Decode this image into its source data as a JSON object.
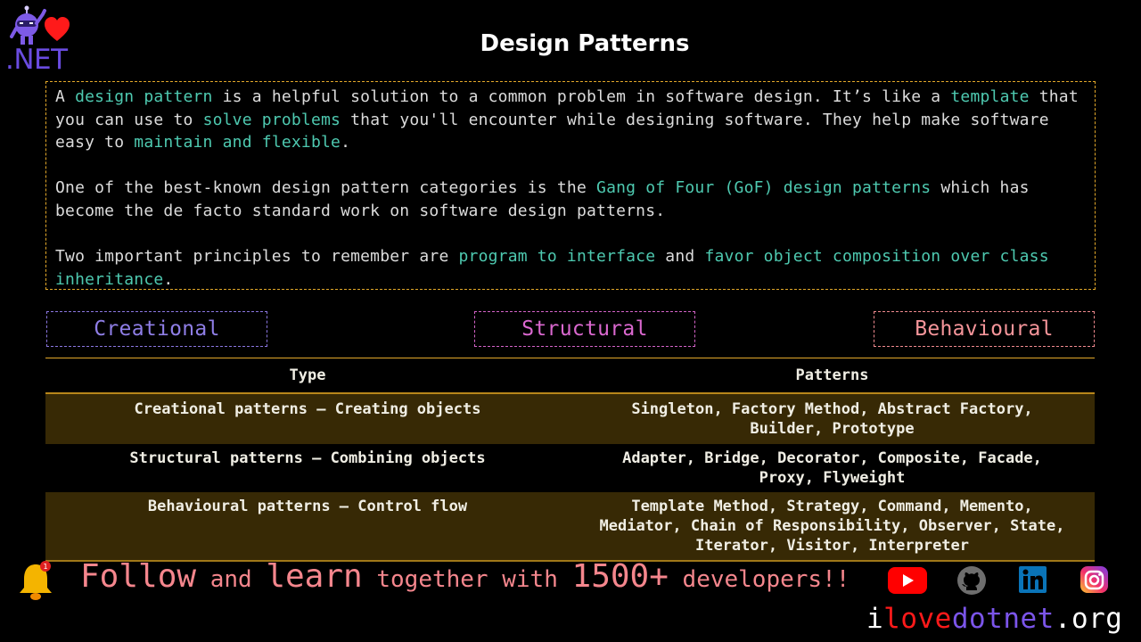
{
  "header": {
    "logo_text": ".NET",
    "title": "Design Patterns"
  },
  "intro": {
    "paragraphs": [
      [
        {
          "t": "A ",
          "hl": false
        },
        {
          "t": "design pattern",
          "hl": true
        },
        {
          "t": " is a helpful solution to a common problem in software design. It’s like a ",
          "hl": false
        },
        {
          "t": "template",
          "hl": true
        },
        {
          "t": " that you can use to ",
          "hl": false
        },
        {
          "t": "solve problems",
          "hl": true
        },
        {
          "t": " that you'll encounter while designing software. They help make software easy to ",
          "hl": false
        },
        {
          "t": "maintain and flexible",
          "hl": true
        },
        {
          "t": ".",
          "hl": false
        }
      ],
      [
        {
          "t": "One of the best-known design pattern categories is the ",
          "hl": false
        },
        {
          "t": "Gang of Four (GoF) design patterns",
          "hl": true
        },
        {
          "t": " which has become the de facto standard work on software design patterns.",
          "hl": false
        }
      ],
      [
        {
          "t": "Two important principles to remember are ",
          "hl": false
        },
        {
          "t": "program to interface",
          "hl": true
        },
        {
          "t": " and ",
          "hl": false
        },
        {
          "t": "favor object composition over class inheritance",
          "hl": true
        },
        {
          "t": ".",
          "hl": false
        }
      ]
    ]
  },
  "categories": {
    "creational": "Creational",
    "structural": "Structural",
    "behavioural": "Behavioural"
  },
  "table": {
    "headers": {
      "type": "Type",
      "patterns": "Patterns"
    },
    "rows": [
      {
        "type": "Creational patterns – Creating objects",
        "patterns": [
          "Singleton, Factory Method, Abstract Factory,",
          "Builder, Prototype"
        ]
      },
      {
        "type": "Structural patterns – Combining objects",
        "patterns": [
          "Adapter, Bridge, Decorator, Composite, Facade,",
          "Proxy, Flyweight"
        ]
      },
      {
        "type": "Behavioural patterns – Control flow",
        "patterns": [
          "Template Method, Strategy, Command, Memento,",
          "Mediator, Chain of Responsibility, Observer, State,",
          "Iterator, Visitor, Interpreter"
        ]
      }
    ]
  },
  "footer": {
    "notification_count": "1",
    "follow": "Follow",
    "and": " and ",
    "learn": "learn",
    "together_with": " together with ",
    "count": "1500+",
    "developers": " developers!!",
    "social": [
      "youtube",
      "github",
      "linkedin",
      "instagram"
    ],
    "site": {
      "i": "i",
      "love": "love",
      "dotnet": "dotnet",
      "org": ".org"
    }
  },
  "colors": {
    "highlight": "#4ec9b0",
    "intro_border": "#e3a82a",
    "creational": "#8f7ee6",
    "structural": "#da68cf",
    "behavioural": "#f5959a",
    "table_band": "#372905",
    "footer_text": "#f5868d"
  }
}
